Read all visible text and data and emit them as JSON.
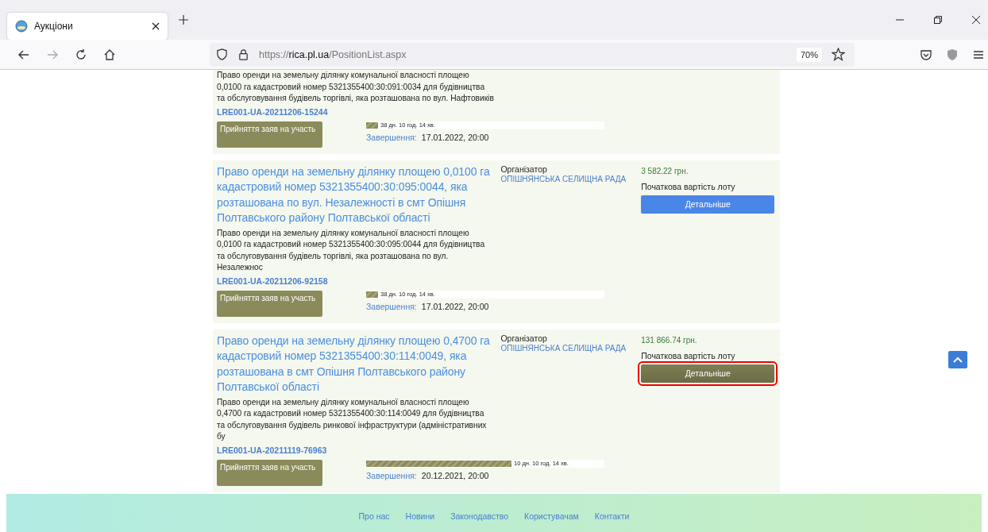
{
  "browser": {
    "tab_title": "Аукціони",
    "url_prefix": "https://",
    "url_host": "rica.pl.ua",
    "url_path": "/PositionList.aspx",
    "zoom": "70%"
  },
  "lots": [
    {
      "description": "Право оренди на земельну ділянку комунальної власності площею 0,0100 га кадастровий номер 5321355400:30:091:0034 для будівництва та обслуговування будівель торгівлі, яка розташована по вул. Нафтовиків",
      "code": "LRE001-UA-20211206-15244",
      "status": "Прийняття заяв на участь",
      "level": 0.05,
      "remaining": "38 дн. 10 год. 14 хв.",
      "end_label": "Завершення:",
      "end_date": "17.01.2022, 20:00"
    },
    {
      "title": "Право оренди на земельну ділянку площею 0,0100 га кадастровий номер 5321355400:30:095:0044, яка розташована по вул. Незалежності в смт Опішня Полтавського району Полтавської області",
      "description": "Право оренди на земельну ділянку комунальної власності площею 0,0100 га кадастровий номер 5321355400:30:095:0044 для будівництва та обслуговування будівель торгівлі, яка розташована по вул. Незалежнос",
      "code": "LRE001-UA-20211206-92158",
      "status": "Прийняття заяв на участь",
      "level": 0.05,
      "remaining": "38 дн. 10 год. 14 хв.",
      "end_label": "Завершення:",
      "end_date": "17.01.2022, 20:00",
      "organizer_label": "Організатор",
      "organizer": "ОПІШНЯНСЬКА СЕЛИЩНА РАДА",
      "price": "3 582.22 грн.",
      "price_label": "Початкова вартість лоту",
      "details": "Детальніше",
      "highlighted": false
    },
    {
      "title": "Право оренди на земельну ділянку площею 0,4700 га кадастровий номер 5321355400:30:114:0049, яка розташована в смт Опішня Полтавського району Полтавської області",
      "description": "Право оренди на земельну ділянку комунальної власності площею 0,4700 га кадастровий номер 5321355400:30:114:0049 для будівництва та обслуговування будівель ринкової інфраструктури (адміністративних бу",
      "code": "LRE001-UA-20211119-76963",
      "status": "Прийняття заяв на участь",
      "level": 0.61,
      "remaining": "10 дн. 10 год. 14 хв.",
      "end_label": "Завершення:",
      "end_date": "20.12.2021, 20:00",
      "organizer_label": "Організатор",
      "organizer": "ОПІШНЯНСЬКА СЕЛИЩНА РАДА",
      "price": "131 866.74 грн.",
      "price_label": "Початкова вартість лоту",
      "details": "Детальніше",
      "highlighted": true
    }
  ],
  "footer_links": [
    "Про нас",
    "Новини",
    "Законодавство",
    "Користувачам",
    "Контакти"
  ]
}
